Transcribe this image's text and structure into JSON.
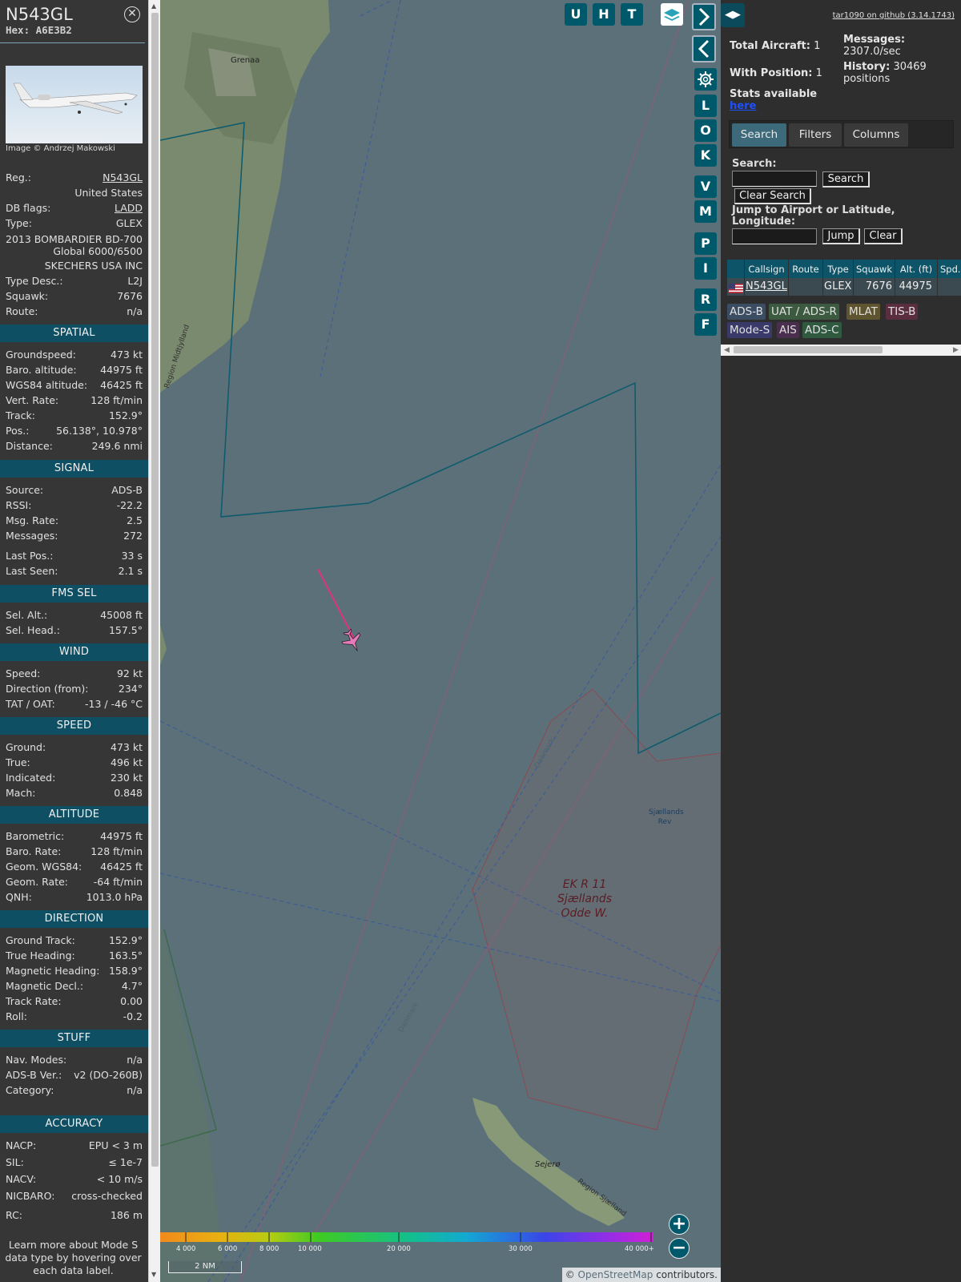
{
  "aircraft": {
    "callsign": "N543GL",
    "hex_label": "Hex:",
    "hex": "A6E3B2",
    "photo_credit": "Image © Andrzej Makowski",
    "details": [
      {
        "k": "Reg.:",
        "v": "N543GL",
        "link": true
      },
      {
        "k": "",
        "v": "United States"
      },
      {
        "k": "DB flags:",
        "v": "LADD",
        "link": true
      },
      {
        "k": "Type:",
        "v": "GLEX"
      },
      {
        "k": "",
        "v": "2013 BOMBARDIER BD-700 Global 6000/6500"
      },
      {
        "k": "",
        "v": "SKECHERS USA INC"
      },
      {
        "k": "Type Desc.:",
        "v": "L2J"
      },
      {
        "k": "Squawk:",
        "v": "7676"
      },
      {
        "k": "Route:",
        "v": "n/a"
      }
    ]
  },
  "sections": {
    "spatial": {
      "title": "SPATIAL",
      "rows": [
        {
          "k": "Groundspeed:",
          "v": "473 kt"
        },
        {
          "k": "Baro. altitude:",
          "v": "44975 ft"
        },
        {
          "k": "WGS84 altitude:",
          "v": "46425 ft"
        },
        {
          "k": "Vert. Rate:",
          "v": "128 ft/min"
        },
        {
          "k": "Track:",
          "v": "152.9°"
        },
        {
          "k": "Pos.:",
          "v": "56.138°, 10.978°"
        },
        {
          "k": "Distance:",
          "v": "249.6 nmi"
        }
      ]
    },
    "signal": {
      "title": "SIGNAL",
      "rows": [
        {
          "k": "Source:",
          "v": "ADS-B"
        },
        {
          "k": "RSSI:",
          "v": "-22.2"
        },
        {
          "k": "Msg. Rate:",
          "v": "2.5"
        },
        {
          "k": "Messages:",
          "v": "272"
        },
        {
          "k": "Last Pos.:",
          "v": "33 s"
        },
        {
          "k": "Last Seen:",
          "v": "2.1 s"
        }
      ]
    },
    "fms": {
      "title": "FMS SEL",
      "rows": [
        {
          "k": "Sel. Alt.:",
          "v": "45008 ft"
        },
        {
          "k": "Sel. Head.:",
          "v": "157.5°"
        }
      ]
    },
    "wind": {
      "title": "WIND",
      "rows": [
        {
          "k": "Speed:",
          "v": "92 kt"
        },
        {
          "k": "Direction (from):",
          "v": "234°"
        },
        {
          "k": "TAT / OAT:",
          "v": "-13 / -46 °C"
        }
      ]
    },
    "speed": {
      "title": "SPEED",
      "rows": [
        {
          "k": "Ground:",
          "v": "473 kt"
        },
        {
          "k": "True:",
          "v": "496 kt"
        },
        {
          "k": "Indicated:",
          "v": "230 kt"
        },
        {
          "k": "Mach:",
          "v": "0.848"
        }
      ]
    },
    "altitude": {
      "title": "ALTITUDE",
      "rows": [
        {
          "k": "Barometric:",
          "v": "44975 ft"
        },
        {
          "k": "Baro. Rate:",
          "v": "128 ft/min"
        },
        {
          "k": "Geom. WGS84:",
          "v": "46425 ft"
        },
        {
          "k": "Geom. Rate:",
          "v": "-64 ft/min"
        },
        {
          "k": "QNH:",
          "v": "1013.0 hPa"
        }
      ]
    },
    "direction": {
      "title": "DIRECTION",
      "rows": [
        {
          "k": "Ground Track:",
          "v": "152.9°"
        },
        {
          "k": "True Heading:",
          "v": "163.5°"
        },
        {
          "k": "Magnetic Heading:",
          "v": "158.9°"
        },
        {
          "k": "Magnetic Decl.:",
          "v": "4.7°"
        },
        {
          "k": "Track Rate:",
          "v": "0.00"
        },
        {
          "k": "Roll:",
          "v": "-0.2"
        }
      ]
    },
    "stuff": {
      "title": "STUFF",
      "rows": [
        {
          "k": "Nav. Modes:",
          "v": "n/a"
        },
        {
          "k": "ADS-B Ver.:",
          "v": "v2 (DO-260B)"
        },
        {
          "k": "Category:",
          "v": "n/a"
        }
      ]
    },
    "accuracy": {
      "title": "ACCURACY",
      "rows": [
        {
          "k": "NACP:",
          "v": "EPU < 3 m"
        },
        {
          "k": "SIL:",
          "v": "≤ 1e-7"
        },
        {
          "k": "NACV:",
          "v": "< 10 m/s"
        },
        {
          "k": "NICBARO:",
          "v": "cross-checked"
        },
        {
          "k": "RC:",
          "v": "186 m"
        }
      ]
    }
  },
  "footer_note": "Learn more about Mode S data type by hovering over each data label.",
  "map": {
    "buttons_top": [
      "U",
      "H",
      "T"
    ],
    "buttons_side": [
      "L",
      "O",
      "K",
      "V",
      "M",
      "P",
      "I",
      "R",
      "F"
    ],
    "labels": {
      "grenaa": "Grenaa",
      "midtjylland": "Region Midtjylland",
      "danmark1": "Danmark",
      "danmark2": "Danmark",
      "sjaellands_rev": "Sjællands Rev",
      "ekr11_line1": "EK R 11",
      "ekr11_line2": "Sjællands",
      "ekr11_line3": "Odde W.",
      "sejero": "Sejerø",
      "region_sjaelland": "Region Sjælland"
    },
    "altitude_labels": [
      "4 000",
      "6 000",
      "8 000",
      "10 000",
      "20 000",
      "30 000",
      "40 000+"
    ],
    "scale": "2 NM",
    "attribution_prefix": "©",
    "attribution_link": "OpenStreetMap",
    "attribution_suffix": "contributors.",
    "track_color": "#e0337e",
    "aircraft_color": "#e879b8"
  },
  "stats": {
    "github": "tar1090 on github (3.14.1743)",
    "total_label": "Total Aircraft:",
    "total": "1",
    "position_label": "With Position:",
    "position": "1",
    "messages_label": "Messages:",
    "messages": "2307.0/sec",
    "history_label": "History:",
    "history": "30469 positions",
    "stats_label": "Stats available",
    "stats_link": "here"
  },
  "tabs": [
    "Search",
    "Filters",
    "Columns"
  ],
  "search": {
    "label": "Search:",
    "button": "Search",
    "clear": "Clear Search",
    "jump_label": "Jump to Airport or Latitude, Longitude:",
    "jump_button": "Jump",
    "clear_button": "Clear"
  },
  "table": {
    "headers": [
      "",
      "Callsign",
      "Route",
      "Type",
      "Squawk",
      "Alt. (ft)",
      "Spd."
    ],
    "rows": [
      {
        "callsign": "N543GL",
        "route": "",
        "type": "GLEX",
        "squawk": "7676",
        "alt": "44975",
        "spd": ""
      }
    ]
  },
  "sources": [
    {
      "label": "ADS-B",
      "color": "#3a4d63"
    },
    {
      "label": "UAT / ADS-R",
      "color": "#3b5a3f"
    },
    {
      "label": "MLAT",
      "color": "#5e5430"
    },
    {
      "label": "TIS-B",
      "color": "#5a2e3f"
    },
    {
      "label": "Mode-S",
      "color": "#3a3a6a"
    },
    {
      "label": "AIS",
      "color": "#4a2e4d"
    },
    {
      "label": "ADS-C",
      "color": "#2f5a40"
    }
  ]
}
